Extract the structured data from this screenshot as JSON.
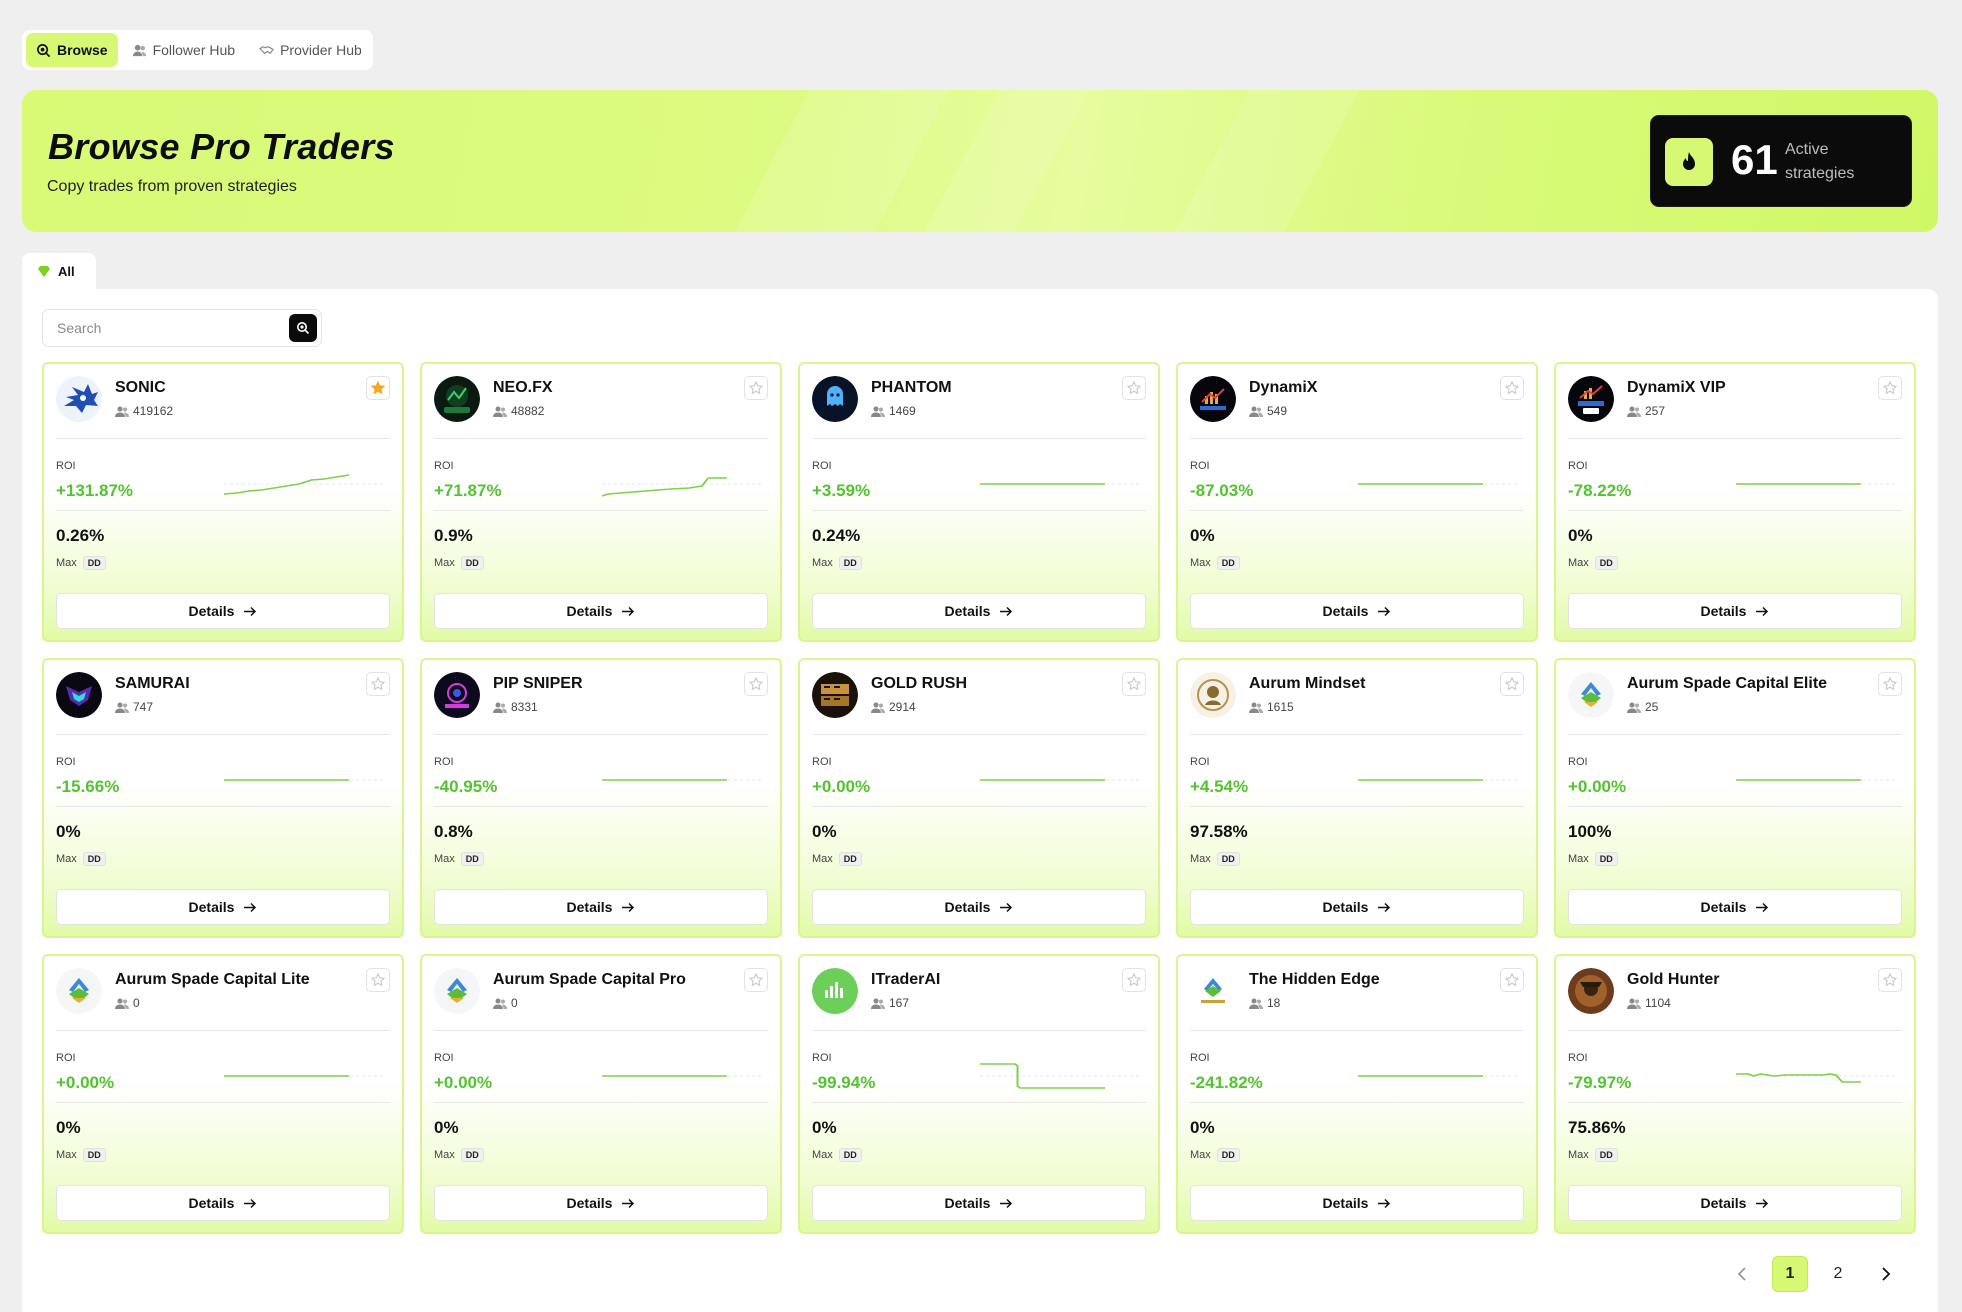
{
  "nav": {
    "browse": "Browse",
    "follower_hub": "Follower Hub",
    "provider_hub": "Provider Hub"
  },
  "hero": {
    "title": "Browse Pro Traders",
    "subtitle": "Copy trades from proven strategies",
    "stat_value": "61",
    "stat_label": "Active strategies"
  },
  "filter": {
    "all": "All"
  },
  "search": {
    "placeholder": "Search"
  },
  "labels": {
    "roi": "ROI",
    "max": "Max",
    "dd": "DD",
    "details": "Details"
  },
  "colors": {
    "accent": "#d6f873",
    "positive": "#55c231",
    "star_active": "#f5a623"
  },
  "cards": [
    {
      "name": "SONIC",
      "followers": "419162",
      "roi": "+131.87%",
      "dd": "0.26%",
      "starred": true,
      "avatar": "sonic-avatar",
      "trend": "up"
    },
    {
      "name": "NEO.FX",
      "followers": "48882",
      "roi": "+71.87%",
      "dd": "0.9%",
      "starred": false,
      "avatar": "neofx-avatar",
      "trend": "step-up"
    },
    {
      "name": "PHANTOM",
      "followers": "1469",
      "roi": "+3.59%",
      "dd": "0.24%",
      "starred": false,
      "avatar": "phantom-avatar",
      "trend": "flat"
    },
    {
      "name": "DynamiX",
      "followers": "549",
      "roi": "-87.03%",
      "dd": "0%",
      "starred": false,
      "avatar": "dynamix-avatar",
      "trend": "flat"
    },
    {
      "name": "DynamiX VIP",
      "followers": "257",
      "roi": "-78.22%",
      "dd": "0%",
      "starred": false,
      "avatar": "dynamix-vip-avatar",
      "trend": "flat"
    },
    {
      "name": "SAMURAI",
      "followers": "747",
      "roi": "-15.66%",
      "dd": "0%",
      "starred": false,
      "avatar": "samurai-avatar",
      "trend": "flat"
    },
    {
      "name": "PIP SNIPER",
      "followers": "8331",
      "roi": "-40.95%",
      "dd": "0.8%",
      "starred": false,
      "avatar": "pip-sniper-avatar",
      "trend": "flat"
    },
    {
      "name": "GOLD RUSH",
      "followers": "2914",
      "roi": "+0.00%",
      "dd": "0%",
      "starred": false,
      "avatar": "gold-rush-avatar",
      "trend": "flat"
    },
    {
      "name": "Aurum Mindset",
      "followers": "1615",
      "roi": "+4.54%",
      "dd": "97.58%",
      "starred": false,
      "avatar": "aurum-mindset-avatar",
      "trend": "flat"
    },
    {
      "name": "Aurum Spade Capital Elite",
      "followers": "25",
      "roi": "+0.00%",
      "dd": "100%",
      "starred": false,
      "avatar": "aurum-spade-avatar",
      "trend": "flat"
    },
    {
      "name": "Aurum Spade Capital Lite",
      "followers": "0",
      "roi": "+0.00%",
      "dd": "0%",
      "starred": false,
      "avatar": "aurum-spade-avatar",
      "trend": "flat"
    },
    {
      "name": "Aurum Spade Capital Pro",
      "followers": "0",
      "roi": "+0.00%",
      "dd": "0%",
      "starred": false,
      "avatar": "aurum-spade-avatar",
      "trend": "flat"
    },
    {
      "name": "ITraderAI",
      "followers": "167",
      "roi": "-99.94%",
      "dd": "0%",
      "starred": false,
      "avatar": "itraderai-avatar",
      "trend": "drop"
    },
    {
      "name": "The Hidden Edge",
      "followers": "18",
      "roi": "-241.82%",
      "dd": "0%",
      "starred": false,
      "avatar": "hidden-edge-avatar",
      "trend": "flat"
    },
    {
      "name": "Gold Hunter",
      "followers": "1104",
      "roi": "-79.97%",
      "dd": "75.86%",
      "starred": false,
      "avatar": "gold-hunter-avatar",
      "trend": "late-drop"
    }
  ],
  "pagination": {
    "pages": [
      "1",
      "2"
    ],
    "current": "1"
  }
}
